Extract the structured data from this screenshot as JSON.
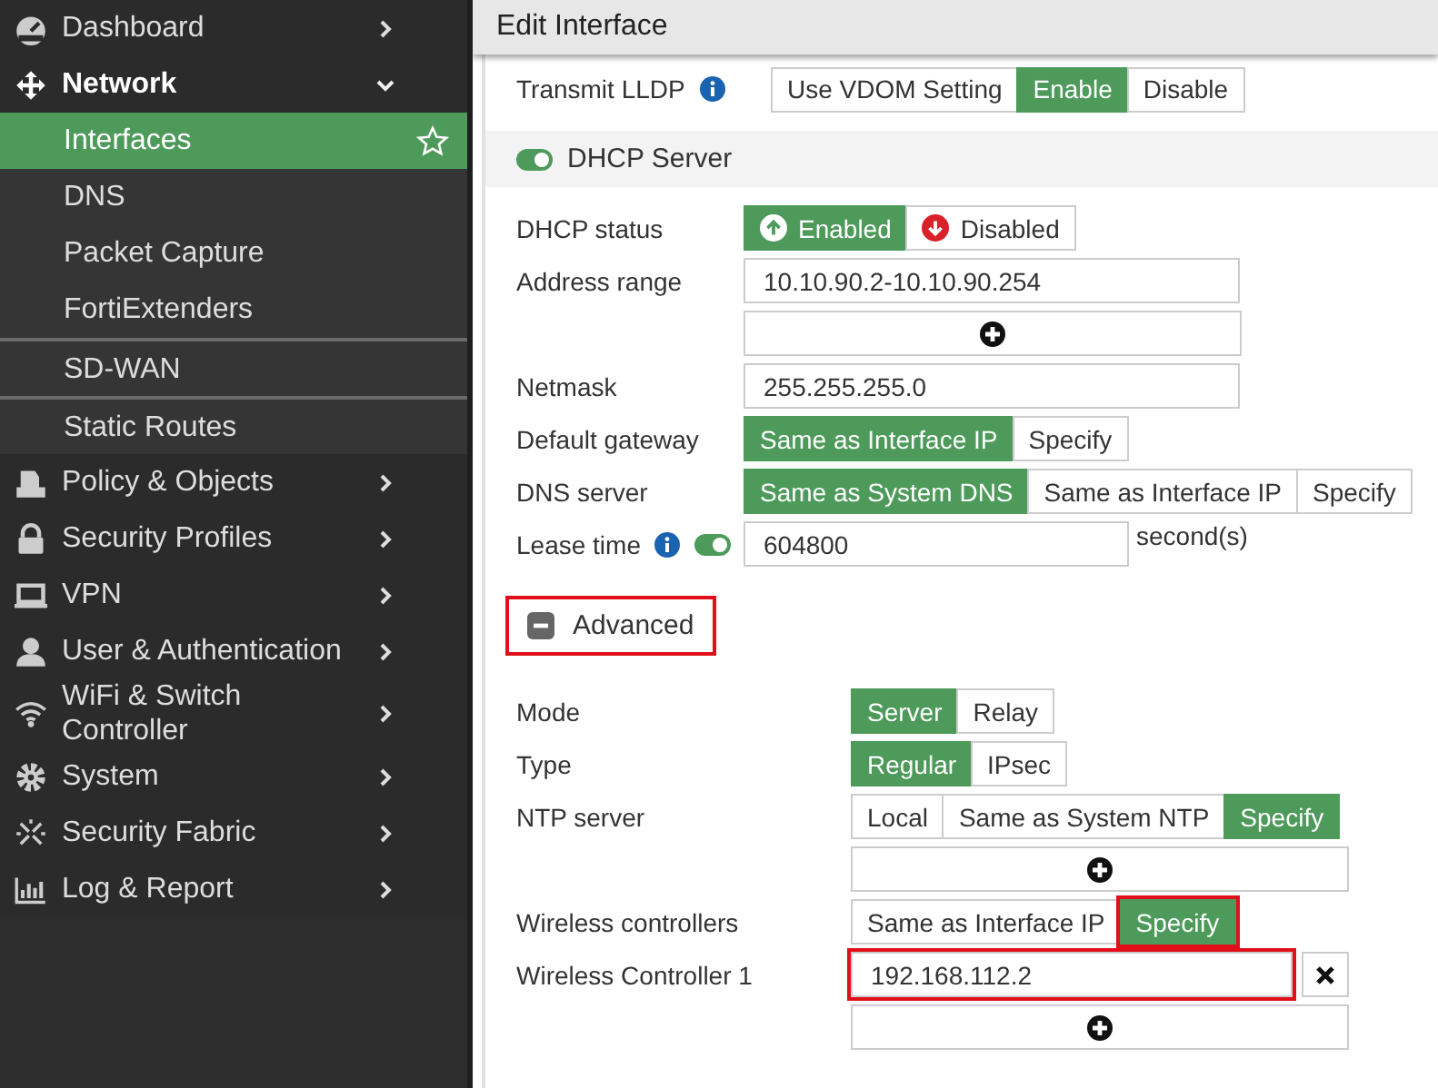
{
  "sidebar": {
    "items": [
      {
        "label": "Dashboard",
        "expanded": false
      },
      {
        "label": "Network",
        "expanded": true,
        "children": [
          {
            "label": "Interfaces",
            "selected": true,
            "separated": false
          },
          {
            "label": "DNS",
            "selected": false,
            "separated": false
          },
          {
            "label": "Packet Capture",
            "selected": false,
            "separated": false
          },
          {
            "label": "FortiExtenders",
            "selected": false,
            "separated": false
          },
          {
            "label": "SD-WAN",
            "selected": false,
            "separated": true
          },
          {
            "label": "Static Routes",
            "selected": false,
            "separated": true
          }
        ]
      },
      {
        "label": "Policy & Objects",
        "expanded": false
      },
      {
        "label": "Security Profiles",
        "expanded": false
      },
      {
        "label": "VPN",
        "expanded": false
      },
      {
        "label": "User & Authentication",
        "expanded": false
      },
      {
        "label": "WiFi & Switch Controller",
        "expanded": false
      },
      {
        "label": "System",
        "expanded": false
      },
      {
        "label": "Security Fabric",
        "expanded": false
      },
      {
        "label": "Log & Report",
        "expanded": false
      }
    ]
  },
  "dialog": {
    "title": "Edit Interface"
  },
  "lldp": {
    "label": "Transmit LLDP",
    "options": [
      {
        "label": "Use VDOM Setting",
        "selected": false
      },
      {
        "label": "Enable",
        "selected": true
      },
      {
        "label": "Disable",
        "selected": false
      }
    ]
  },
  "dhcp_server": {
    "title": "DHCP Server",
    "on": true,
    "rows": [
      {
        "kind": "status",
        "label": "DHCP status",
        "options": [
          {
            "label": "Enabled",
            "selected": true
          },
          {
            "label": "Disabled",
            "selected": false
          }
        ]
      },
      {
        "kind": "input",
        "label": "Address range",
        "value": "10.10.90.2-10.10.90.254"
      },
      {
        "kind": "add"
      },
      {
        "kind": "input",
        "label": "Netmask",
        "value": "255.255.255.0"
      },
      {
        "kind": "segmented",
        "label": "Default gateway",
        "options": [
          {
            "label": "Same as Interface IP",
            "selected": true
          },
          {
            "label": "Specify",
            "selected": false
          }
        ]
      },
      {
        "kind": "segmented",
        "label": "DNS server",
        "options": [
          {
            "label": "Same as System DNS",
            "selected": true
          },
          {
            "label": "Same as Interface IP",
            "selected": false
          },
          {
            "label": "Specify",
            "selected": false
          }
        ]
      },
      {
        "kind": "lease",
        "label": "Lease time",
        "on": true,
        "value": "604800",
        "unit": "second(s)"
      }
    ]
  },
  "advanced": {
    "label": "Advanced",
    "expanded": true,
    "highlighted": true,
    "rows": [
      {
        "kind": "segmented",
        "label": "Mode",
        "options": [
          {
            "label": "Server",
            "selected": true,
            "highlighted": false
          },
          {
            "label": "Relay",
            "selected": false,
            "highlighted": false
          }
        ]
      },
      {
        "kind": "segmented",
        "label": "Type",
        "options": [
          {
            "label": "Regular",
            "selected": true,
            "highlighted": false
          },
          {
            "label": "IPsec",
            "selected": false,
            "highlighted": false
          }
        ]
      },
      {
        "kind": "segmented",
        "label": "NTP server",
        "options": [
          {
            "label": "Local",
            "selected": false,
            "highlighted": false
          },
          {
            "label": "Same as System NTP",
            "selected": false,
            "highlighted": false
          },
          {
            "label": "Specify",
            "selected": true,
            "highlighted": false
          }
        ]
      },
      {
        "kind": "add"
      },
      {
        "kind": "segmented",
        "label": "Wireless controllers",
        "options": [
          {
            "label": "Same as Interface IP",
            "selected": false,
            "highlighted": false
          },
          {
            "label": "Specify",
            "selected": true,
            "highlighted": true
          }
        ]
      },
      {
        "kind": "removable",
        "label": "Wireless Controller 1",
        "value": "192.168.112.2",
        "highlighted": true
      },
      {
        "kind": "add"
      }
    ]
  }
}
